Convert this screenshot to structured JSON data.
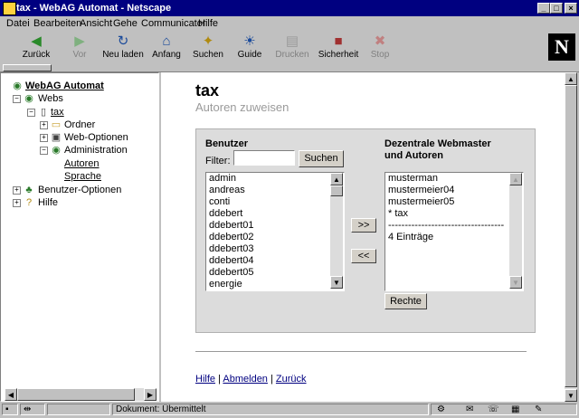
{
  "window": {
    "title": "tax - WebAG Automat - Netscape",
    "controls": [
      "_",
      "□",
      "×"
    ]
  },
  "menu": [
    "Datei",
    "Bearbeiten",
    "Ansicht",
    "Gehe",
    "Communicator",
    "Hilfe"
  ],
  "toolbar": {
    "back": "Zurück",
    "forward": "Vor",
    "reload": "Neu laden",
    "home": "Anfang",
    "search": "Suchen",
    "guide": "Guide",
    "print": "Drucken",
    "security": "Sicherheit",
    "stop": "Stop",
    "logo": "N"
  },
  "tree": {
    "root": "WebAG Automat",
    "webs": "Webs",
    "tax": "tax",
    "ordner": "Ordner",
    "weboptionen": "Web-Optionen",
    "administration": "Administration",
    "autoren": "Autoren",
    "sprache": "Sprache",
    "benutzeroptionen": "Benutzer-Optionen",
    "hilfe": "Hilfe"
  },
  "page": {
    "title": "tax",
    "subtitle": "Autoren zuweisen"
  },
  "benutzer": {
    "heading": "Benutzer",
    "filter_label": "Filter:",
    "filter_value": "",
    "search_button": "Suchen",
    "items": [
      "admin",
      "andreas",
      "conti",
      "ddebert",
      "ddebert01",
      "ddebert02",
      "ddebert03",
      "ddebert04",
      "ddebert05",
      "energie"
    ]
  },
  "transfer": {
    "add": ">>",
    "remove": "<<"
  },
  "autoren": {
    "heading_line1": "Dezentrale Webmaster",
    "heading_line2": "und Autoren",
    "items": [
      "musterman",
      "mustermeier04",
      "mustermeier05",
      "* tax"
    ],
    "separator": "----------------------------------------",
    "count": "4 Einträge",
    "rights_button": "Rechte"
  },
  "footer": {
    "hilfe": "Hilfe",
    "sep1": " | ",
    "abmelden": "Abmelden",
    "sep2": " | ",
    "zurueck": "Zurück"
  },
  "status": {
    "text": "Dokument: Übermittelt"
  }
}
